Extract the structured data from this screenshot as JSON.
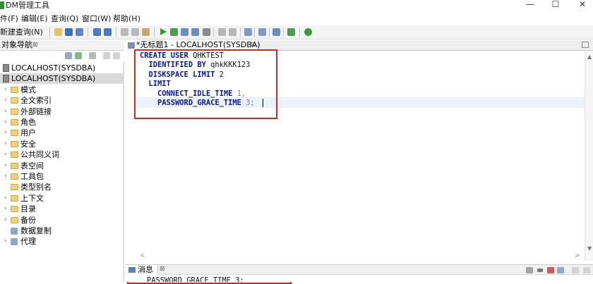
{
  "window": {
    "title": "DM管理工具",
    "min_glyph": "—",
    "max_glyph": "☐",
    "close_glyph": "✕"
  },
  "menu": [
    "件(F)",
    "编辑(E)",
    "查询(Q)",
    "窗口(W)",
    "帮助(H)"
  ],
  "toolbar": {
    "new_query_label": "新建查询(N)"
  },
  "navigator": {
    "title": "对象导航",
    "close_glyph": "⊠",
    "items": [
      {
        "label": "LOCALHOST(SYSDBA)",
        "icon": "server-icon",
        "selected": false,
        "level": 0
      },
      {
        "label": "LOCALHOST(SYSDBA)",
        "icon": "server-icon",
        "selected": true,
        "level": 0
      },
      {
        "label": "模式",
        "icon": "folder-icon",
        "level": 1,
        "chevron": true
      },
      {
        "label": "全文索引",
        "icon": "folder-icon",
        "level": 1,
        "chevron": true
      },
      {
        "label": "外部链接",
        "icon": "folder-icon",
        "level": 1,
        "chevron": true
      },
      {
        "label": "角色",
        "icon": "folder-icon",
        "level": 1,
        "chevron": true
      },
      {
        "label": "用户",
        "icon": "folder-icon",
        "level": 1,
        "chevron": true
      },
      {
        "label": "安全",
        "icon": "folder-icon",
        "level": 1,
        "chevron": true
      },
      {
        "label": "公共同义词",
        "icon": "folder-icon",
        "level": 1,
        "chevron": true
      },
      {
        "label": "表空间",
        "icon": "folder-icon",
        "level": 1,
        "chevron": true
      },
      {
        "label": "工具包",
        "icon": "folder-icon",
        "level": 1,
        "chevron": true
      },
      {
        "label": "类型别名",
        "icon": "folder-icon",
        "level": 1,
        "chevron": false
      },
      {
        "label": "上下文",
        "icon": "folder-icon",
        "level": 1,
        "chevron": true
      },
      {
        "label": "目录",
        "icon": "folder-icon",
        "level": 1,
        "chevron": true
      },
      {
        "label": "备份",
        "icon": "folder-icon",
        "level": 1,
        "chevron": true
      },
      {
        "label": "数据复制",
        "icon": "gear-icon",
        "level": 1,
        "chevron": false
      },
      {
        "label": "代理",
        "icon": "gear-icon",
        "level": 1,
        "chevron": true
      }
    ]
  },
  "editor": {
    "tab_label": "*无标题1 - LOCALHOST(SYSDBA)",
    "tab_close_glyph": "⊠",
    "lines": [
      [
        {
          "t": "CREATE USER ",
          "c": "kw"
        },
        {
          "t": "QHKTEST",
          "c": "pl"
        }
      ],
      [
        {
          "t": "  IDENTIFIED BY ",
          "c": "kw"
        },
        {
          "t": "qhkKKK123",
          "c": "pl"
        }
      ],
      [
        {
          "t": "  DISKSPACE LIMIT ",
          "c": "kw"
        },
        {
          "t": "2",
          "c": "pl"
        }
      ],
      [
        {
          "t": "  LIMIT",
          "c": "kw"
        }
      ],
      [
        {
          "t": "    CONNECT_IDLE_TIME ",
          "c": "kw"
        },
        {
          "t": "1,",
          "c": "nm"
        }
      ],
      [
        {
          "t": "    PASSWORD_GRACE_TIME ",
          "c": "kw"
        },
        {
          "t": "3;",
          "c": "nm"
        }
      ]
    ]
  },
  "messages": {
    "tab_label": "消息",
    "tab_close_glyph": "⊠",
    "text": "PASSWORD_GRACE_TIME 3;"
  },
  "colors": {
    "keyword": "#0a13a0",
    "highlight_box": "#e02424",
    "current_line": "#e9f1fb"
  }
}
